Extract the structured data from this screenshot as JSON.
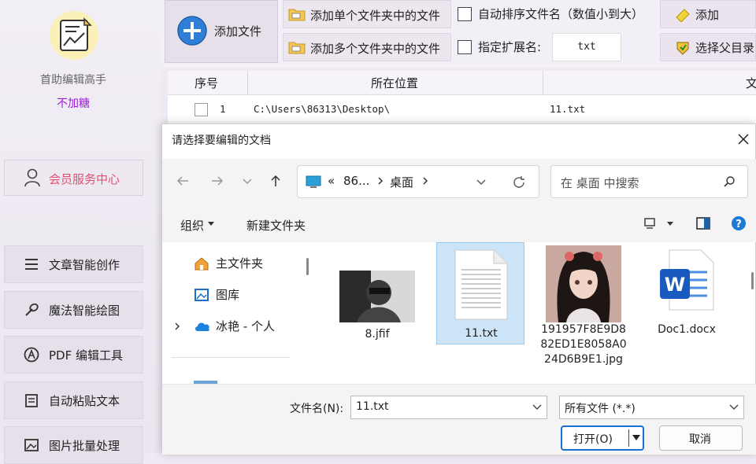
{
  "sidebar": {
    "app_name": "首助编辑高手",
    "app_tag": "不加糖",
    "member_label": "会员服务中心",
    "nav": [
      {
        "label": "文章智能创作",
        "icon": "list-icon"
      },
      {
        "label": "魔法智能绘图",
        "icon": "magic-wand-icon"
      },
      {
        "label": "PDF 编辑工具",
        "icon": "pdf-icon"
      },
      {
        "label": "自动粘贴文本",
        "icon": "paste-icon"
      },
      {
        "label": "图片批量处理",
        "icon": "image-icon"
      }
    ]
  },
  "toolbar": {
    "add_file": "添加文件",
    "add_single_folder": "添加单个文件夹中的文件",
    "add_multi_folder": "添加多个文件夹中的文件",
    "auto_sort": "自动排序文件名（数值小到大）",
    "specify_ext": "指定扩展名:",
    "ext_value": "txt",
    "add_right": "添加",
    "choose_parent": "选择父目录"
  },
  "table": {
    "headers": [
      "序号",
      "所在位置",
      "文"
    ],
    "rows": [
      {
        "index": "1",
        "location": "C:\\Users\\86313\\Desktop\\",
        "name": "11.txt"
      }
    ]
  },
  "dialog": {
    "title": "请选择要编辑的文档",
    "address": {
      "prefix": "«",
      "segment1": "86...",
      "segment2": "桌面"
    },
    "search_placeholder": "在 桌面 中搜索",
    "organize": "组织",
    "new_folder": "新建文件夹",
    "nav_items": [
      {
        "label": "主文件夹",
        "icon": "home-icon"
      },
      {
        "label": "图库",
        "icon": "gallery-icon"
      },
      {
        "label": "冰艳 - 个人",
        "icon": "cloud-icon"
      }
    ],
    "files": [
      {
        "name": "8.jfif",
        "icon": "photo-thumbnail-icon"
      },
      {
        "name": "11.txt",
        "icon": "text-file-icon",
        "selected": true
      },
      {
        "name": "191957F8E9D882ED1E8058A024D6B9E1.jpg",
        "icon": "anime-thumbnail-icon"
      },
      {
        "name": "Doc1.docx",
        "icon": "word-icon"
      }
    ],
    "filename_label": "文件名(N):",
    "filename_value": "11.txt",
    "filetype_value": "所有文件 (*.*)",
    "open_label": "打开(O)",
    "cancel_label": "取消"
  },
  "colors": {
    "accent_purple": "#9b1fd6",
    "member_pink": "#e05070",
    "select_blue": "#cce4f7",
    "word_blue": "#185abd"
  }
}
